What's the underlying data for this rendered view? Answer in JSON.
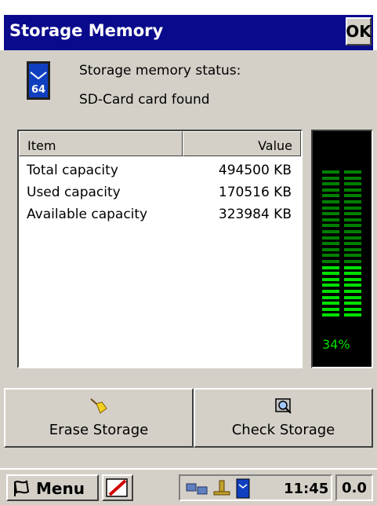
{
  "window": {
    "title": "Storage Memory",
    "ok_label": "OK"
  },
  "status": {
    "label": "Storage memory status:",
    "value": "SD-Card card found",
    "card_icon_text": "64"
  },
  "table": {
    "columns": [
      "Item",
      "Value"
    ],
    "rows": [
      {
        "item": "Total capacity",
        "value": "494500 KB"
      },
      {
        "item": "Used capacity",
        "value": "170516 KB"
      },
      {
        "item": "Available capacity",
        "value": "323984 KB"
      }
    ]
  },
  "meter": {
    "percent_label": "34%",
    "fill_fraction": 0.34,
    "lit_color": "#00e000",
    "dim_color": "#008000"
  },
  "buttons": {
    "erase_label": "Erase Storage",
    "check_label": "Check Storage"
  },
  "taskbar": {
    "menu_label": "Menu",
    "clock": "11:45",
    "version": "0.0"
  },
  "colors": {
    "title_bg": "#0a0a8c",
    "face": "#d4d0c8"
  }
}
